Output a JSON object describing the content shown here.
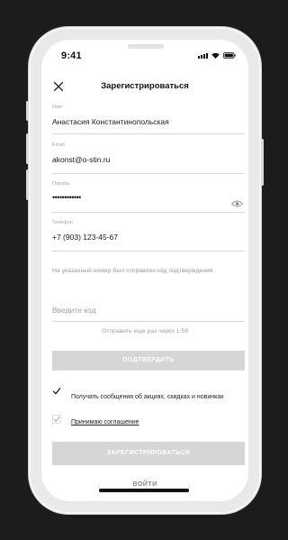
{
  "status_bar": {
    "time": "9:41"
  },
  "header": {
    "title": "Зарегистрироваться"
  },
  "form": {
    "name": {
      "label": "Имя",
      "value": "Анастасия Константинопольская"
    },
    "email": {
      "label": "Email",
      "value": "akonst@o-stin.ru"
    },
    "password": {
      "label": "Пароль",
      "value": "••••••••••••"
    },
    "phone": {
      "label": "Телефон",
      "value": "+7 (903) 123-45-67"
    },
    "sms_hint": "На указанный номер был отправлен код подтверждения",
    "code": {
      "placeholder": "Введите код"
    },
    "resend": "Отправить еще раз через 1:59",
    "confirm_label": "ПОДТВЕРДИТЬ",
    "checkboxes": [
      {
        "label": "Получать сообщения об акциях, скидках и новинках",
        "checked": true
      },
      {
        "label": "Принимаю соглашение",
        "checked": true
      }
    ],
    "register_label": "ЗАРЕГИСТРИРОВАТЬСЯ",
    "login_label": "ВОЙТИ"
  },
  "icons": {
    "close": "close-icon",
    "eye": "eye-icon",
    "check": "check-icon",
    "signal": "signal-icon",
    "wifi": "wifi-icon",
    "battery": "battery-icon"
  },
  "colors": {
    "background": "#1c1c1c",
    "phone_frame": "#e9e9ea",
    "button_disabled": "#d6d6d6",
    "text_primary": "#1a1a1a",
    "text_muted": "#a0a0a0"
  }
}
